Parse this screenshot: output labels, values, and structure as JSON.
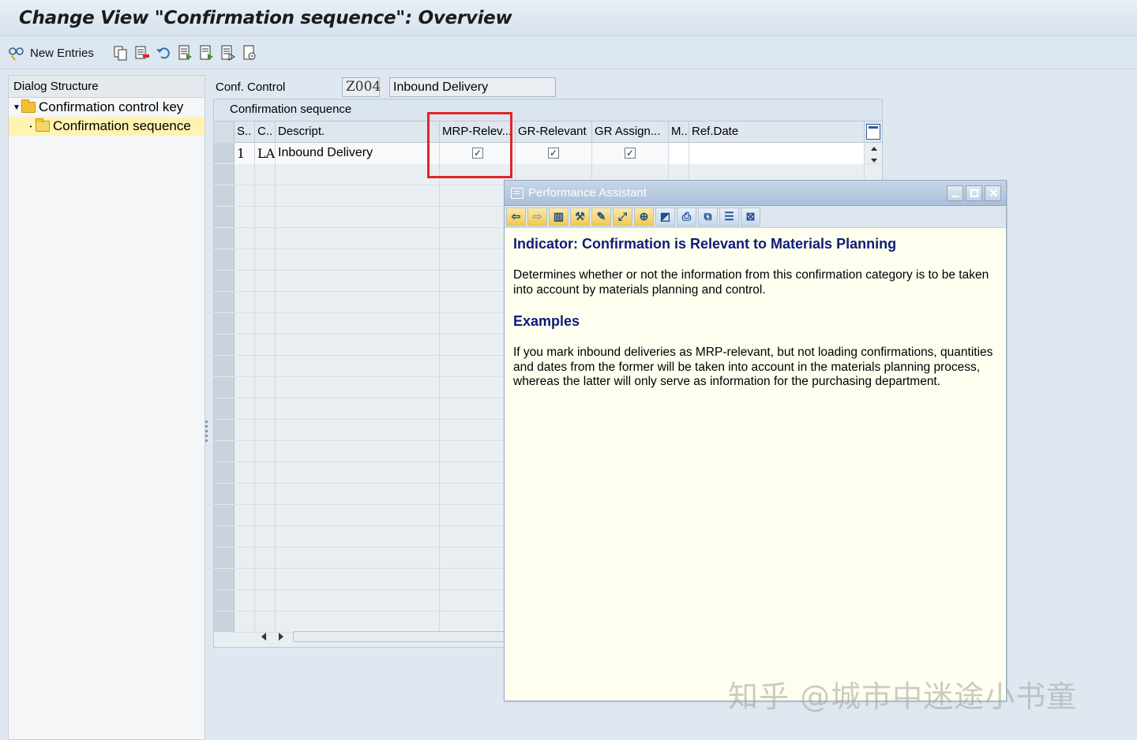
{
  "window": {
    "title": "Change View \"Confirmation sequence\": Overview"
  },
  "toolbar": {
    "new_entries_label": "New Entries"
  },
  "dialog_structure": {
    "header": "Dialog Structure",
    "items": [
      {
        "label": "Confirmation control key"
      },
      {
        "label": "Confirmation sequence"
      }
    ]
  },
  "conf_control": {
    "label": "Conf. Control",
    "code": "Z004",
    "description": "Inbound Delivery"
  },
  "table": {
    "title": "Confirmation sequence",
    "columns": [
      "S..",
      "C..",
      "Descript.",
      "MRP-Relev...",
      "GR-Relevant",
      "GR Assign...",
      "M..",
      "Ref.Date"
    ],
    "rows": [
      {
        "seq": "1",
        "category": "LA",
        "description": "Inbound Delivery",
        "mrp_relevant": "✓",
        "gr_relevant": "✓",
        "gr_assign": "✓",
        "m": "",
        "ref_date": ""
      }
    ]
  },
  "performance_assistant": {
    "title": "Performance Assistant",
    "heading": "Indicator: Confirmation is Relevant to Materials Planning",
    "paragraph1": "Determines whether or not the information from this confirmation category is to be taken into account by materials planning and control.",
    "examples_heading": "Examples",
    "paragraph2": "If you mark inbound deliveries as MRP-relevant, but not loading confirmations, quantities and dates from the former will be taken into account in the materials planning process, whereas the latter will only serve as information for the purchasing department."
  },
  "watermark": "知乎 @城市中迷途小书童",
  "colors": {
    "highlight_box": "#e0252a",
    "assistant_heading": "#0c1d78",
    "selected_tree_item": "#fff3b0"
  }
}
